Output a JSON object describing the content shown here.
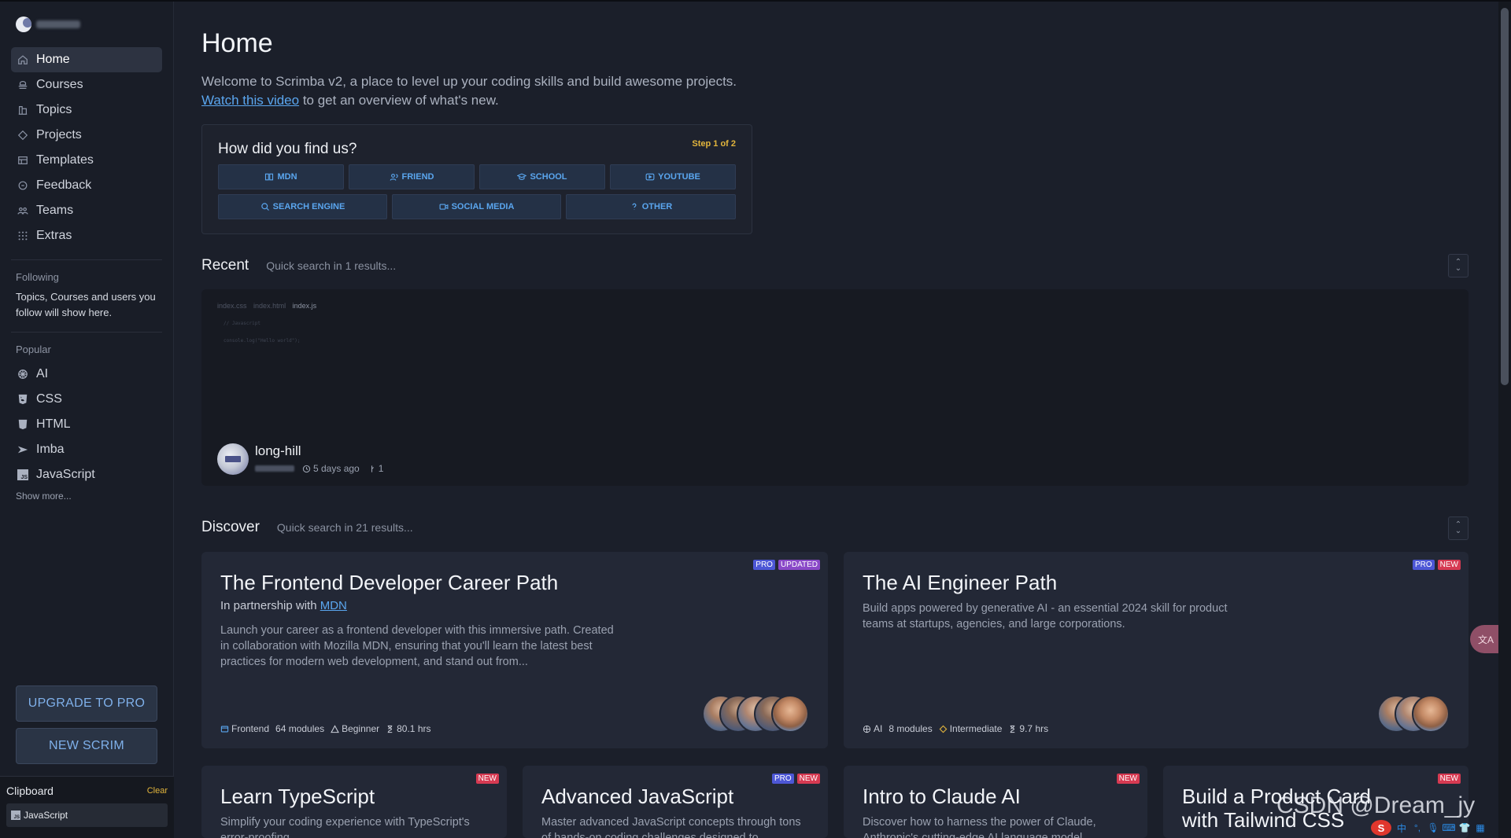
{
  "sidebar": {
    "nav": [
      {
        "label": "Home",
        "icon": "home-icon"
      },
      {
        "label": "Courses",
        "icon": "courses-icon"
      },
      {
        "label": "Topics",
        "icon": "topics-icon"
      },
      {
        "label": "Projects",
        "icon": "projects-icon"
      },
      {
        "label": "Templates",
        "icon": "templates-icon"
      },
      {
        "label": "Feedback",
        "icon": "feedback-icon"
      },
      {
        "label": "Teams",
        "icon": "teams-icon"
      },
      {
        "label": "Extras",
        "icon": "extras-icon"
      }
    ],
    "following_heading": "Following",
    "following_text": "Topics, Courses and users you follow will show here.",
    "popular_heading": "Popular",
    "popular": [
      {
        "label": "AI",
        "icon": "ai-icon"
      },
      {
        "label": "CSS",
        "icon": "css-icon"
      },
      {
        "label": "HTML",
        "icon": "html-icon"
      },
      {
        "label": "Imba",
        "icon": "imba-icon"
      },
      {
        "label": "JavaScript",
        "icon": "javascript-icon"
      }
    ],
    "show_more": "Show more...",
    "upgrade_label": "UPGRADE TO PRO",
    "new_scrim_label": "NEW SCRIM",
    "clipboard": {
      "title": "Clipboard",
      "clear": "Clear",
      "item": "JavaScript"
    }
  },
  "main": {
    "title": "Home",
    "welcome_line1": "Welcome to Scrimba v2, a place to level up your coding skills and build awesome projects.",
    "welcome_link": "Watch this video",
    "welcome_line2_rest": " to get an overview of what's new.",
    "survey": {
      "question": "How did you find us?",
      "step": "Step 1 of 2",
      "options": [
        "MDN",
        "FRIEND",
        "SCHOOL",
        "YOUTUBE",
        "SEARCH ENGINE",
        "SOCIAL MEDIA",
        "OTHER"
      ]
    },
    "recent": {
      "title": "Recent",
      "search_placeholder": "Quick search in 1 results...",
      "card": {
        "tabs": [
          "index.css",
          "index.html",
          "index.js"
        ],
        "code_lines": [
          "// Javascript",
          "console.log(\"Hello world\");"
        ],
        "name": "long-hill",
        "time": "5 days ago",
        "forks": "1"
      }
    },
    "discover": {
      "title": "Discover",
      "search_placeholder": "Quick search in 21 results...",
      "cards": [
        {
          "title": "The Frontend Developer Career Path",
          "subtitle_prefix": "In partnership with ",
          "subtitle_link": "MDN",
          "desc": "Launch your career as a frontend developer with this immersive path. Created in collaboration with Mozilla MDN, ensuring that you'll learn the latest best practices for modern web development, and stand out from...",
          "badges": [
            "PRO",
            "UPDATED"
          ],
          "topic": "Frontend",
          "modules": "64 modules",
          "level": "Beginner",
          "hours": "80.1 hrs"
        },
        {
          "title": "The AI Engineer Path",
          "desc": "Build apps powered by generative AI - an essential 2024 skill for product teams at startups, agencies, and large corporations.",
          "badges": [
            "PRO",
            "NEW"
          ],
          "topic": "AI",
          "modules": "8 modules",
          "level": "Intermediate",
          "hours": "9.7 hrs"
        },
        {
          "title": "Learn TypeScript",
          "desc": "Simplify your coding experience with TypeScript's error-proofing",
          "badges": [
            "NEW"
          ]
        },
        {
          "title": "Advanced JavaScript",
          "desc": "Master advanced JavaScript concepts through tons of hands-on coding challenges designed to",
          "badges": [
            "PRO",
            "NEW"
          ]
        },
        {
          "title": "Intro to Claude AI",
          "desc": "Discover how to harness the power of Claude, Anthropic's cutting-edge AI language model",
          "badges": [
            "NEW"
          ]
        },
        {
          "title": "Build a Product Card with Tailwind CSS",
          "desc": "",
          "badges": [
            "NEW"
          ]
        }
      ]
    }
  },
  "overlay": {
    "translate_button": "文A",
    "watermark": "CSDN @Dream_jy",
    "ime_logo": "S",
    "ime_lang": "中"
  },
  "colors": {
    "background": "#1b1f2a",
    "sidebar": "#191d27",
    "card": "#232836",
    "accent_blue": "#5aa6ef",
    "accent_yellow": "#e2b53c",
    "badge_pro": "#4d57d6",
    "badge_new": "#d63a52",
    "badge_updated": "#8a49c8"
  }
}
